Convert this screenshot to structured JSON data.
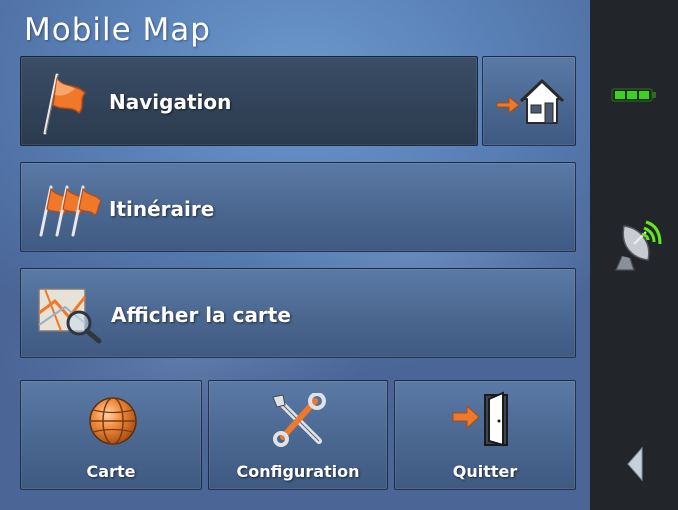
{
  "app": {
    "title": "Mobile Map"
  },
  "menu": {
    "navigation_label": "Navigation",
    "itinerary_label": "Itinéraire",
    "show_map_label": "Afficher la carte",
    "map_label": "Carte",
    "config_label": "Configuration",
    "quit_label": "Quitter"
  },
  "status": {
    "battery_level": 1.0,
    "gps_connected": true
  },
  "colors": {
    "accent_orange": "#f0782a",
    "battery_green": "#3cd21e",
    "gps_green": "#64e61e"
  },
  "icons": [
    "flag-icon",
    "home-icon",
    "flags-icon",
    "map-search-icon",
    "globe-icon",
    "tools-icon",
    "exit-door-icon",
    "battery-icon",
    "satellite-icon",
    "arrow-left-icon"
  ]
}
